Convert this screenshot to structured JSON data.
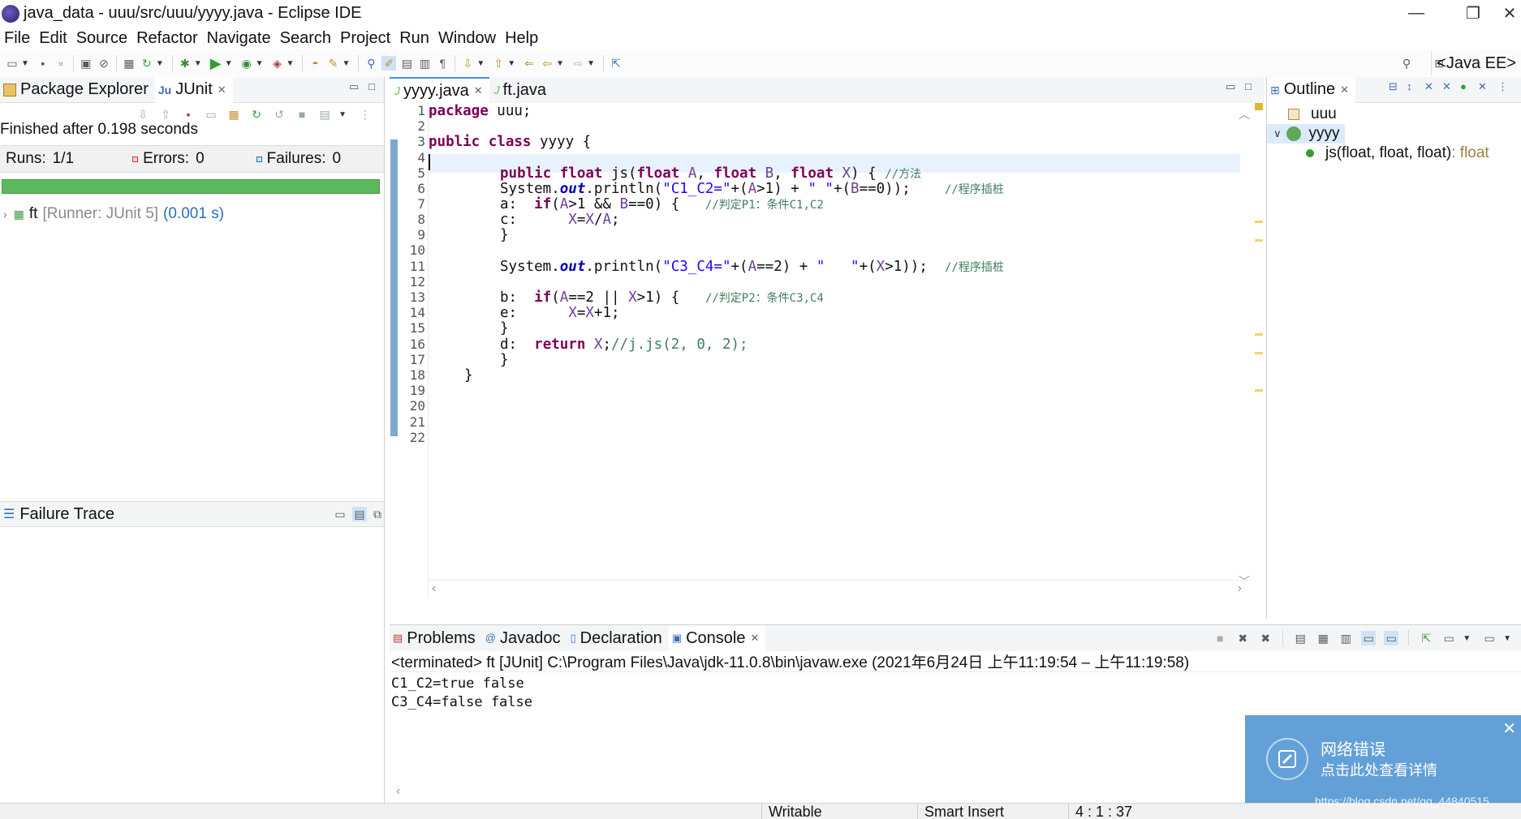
{
  "window": {
    "title": "java_data - uuu/src/uuu/yyyy.java - Eclipse IDE",
    "minimize": "—",
    "restore": "❐",
    "close": "✕"
  },
  "menu": [
    "File",
    "Edit",
    "Source",
    "Refactor",
    "Navigate",
    "Search",
    "Project",
    "Run",
    "Window",
    "Help"
  ],
  "perspective": "<Java EE>",
  "left": {
    "tabs": [
      "Package Explorer",
      "JUnit"
    ],
    "finished": "Finished after 0.198 seconds",
    "runs_label": "Runs:",
    "runs_value": "1/1",
    "errors_label": "Errors:",
    "errors_value": "0",
    "failures_label": "Failures:",
    "failures_value": "0",
    "progress_fraction": 1.0,
    "progress_color": "#5bb85b",
    "tree": {
      "name": "ft",
      "runner": "[Runner: JUnit 5]",
      "time": "(0.001 s)"
    },
    "failure_trace": "Failure Trace"
  },
  "editor": {
    "tabs": [
      "yyyy.java",
      "ft.java"
    ],
    "line_numbers": [
      "1",
      "2",
      "3",
      "4",
      "5",
      "6",
      "7",
      "8",
      "9",
      "10",
      "11",
      "12",
      "13",
      "14",
      "15",
      "16",
      "17",
      "18",
      "19",
      "20",
      "21",
      "22"
    ],
    "lines": {
      "l1_kw": "package",
      "l1_rest": " uuu;",
      "l3_kw1": "public",
      "l3_kw2": "class",
      "l3_rest": " yyyy {",
      "l5_kw1": "public",
      "l5_kw2": "float",
      "l5_name": " js(",
      "l5_kw3": "float",
      "l5_p1": " A",
      "l5_c1": ", ",
      "l5_kw4": "float",
      "l5_p2": " B",
      "l5_c2": ", ",
      "l5_kw5": "float",
      "l5_p3": " X",
      "l5_end": ") { ",
      "l5_cmt": "//方法",
      "l6_a": "System.",
      "l6_fld": "out",
      "l6_b": ".println(",
      "l6_s1": "\"C1_C2=\"",
      "l6_c": "+(",
      "l6_p1": "A",
      "l6_d": ">1) + ",
      "l6_s2": "\" \"",
      "l6_e": "+(",
      "l6_p2": "B",
      "l6_f": "==0));    ",
      "l6_cmt": "//程序插桩",
      "l7_lbl": "a:  ",
      "l7_kw": "if",
      "l7_a": "(",
      "l7_p1": "A",
      "l7_b": ">1 && ",
      "l7_p2": "B",
      "l7_c": "==0) {   ",
      "l7_cmt": "//判定P1：条件C1,C2",
      "l8_lbl": "c:      ",
      "l8_p1": "X",
      "l8_a": "=",
      "l8_p2": "X",
      "l8_b": "/",
      "l8_p3": "A",
      "l8_c": ";",
      "l9": "}",
      "l11_a": "System.",
      "l11_fld": "out",
      "l11_b": ".println(",
      "l11_s1": "\"C3_C4=\"",
      "l11_c": "+(",
      "l11_p1": "A",
      "l11_d": "==2) + ",
      "l11_s2": "\"   \"",
      "l11_e": "+(",
      "l11_p2": "X",
      "l11_f": ">1));  ",
      "l11_cmt": "//程序插桩",
      "l13_lbl": "b:  ",
      "l13_kw": "if",
      "l13_a": "(",
      "l13_p1": "A",
      "l13_b": "==2 || ",
      "l13_p2": "X",
      "l13_c": ">1) {   ",
      "l13_cmt": "//判定P2：条件C3,C4",
      "l14_lbl": "e:      ",
      "l14_p1": "X",
      "l14_a": "=",
      "l14_p2": "X",
      "l14_b": "+1;",
      "l15": "}",
      "l16_lbl": "d:  ",
      "l16_kw": "return",
      "l16_p1": " X",
      "l16_a": ";",
      "l16_cmt": "//j.js(2, 0, 2);",
      "l17": "}",
      "l18": "}"
    }
  },
  "outline": {
    "tab": "Outline",
    "package": "uuu",
    "class": "yyyy",
    "method": "js(float, float, float)",
    "method_type": " : float"
  },
  "console": {
    "tabs": [
      "Problems",
      "Javadoc",
      "Declaration",
      "Console"
    ],
    "header": "<terminated> ft [JUnit] C:\\Program Files\\Java\\jdk-11.0.8\\bin\\javaw.exe  (2021年6月24日 上午11:19:54 – 上午11:19:58)",
    "output": [
      "C1_C2=true false",
      "C3_C4=false   false"
    ]
  },
  "status": {
    "writable": "Writable",
    "insert": "Smart Insert",
    "position": "4 : 1 : 37"
  },
  "notification": {
    "title": "网络错误",
    "subtitle": "点击此处查看详情",
    "close": "✕"
  },
  "watermark": "https://blog.csdn.net/qq_44840515"
}
